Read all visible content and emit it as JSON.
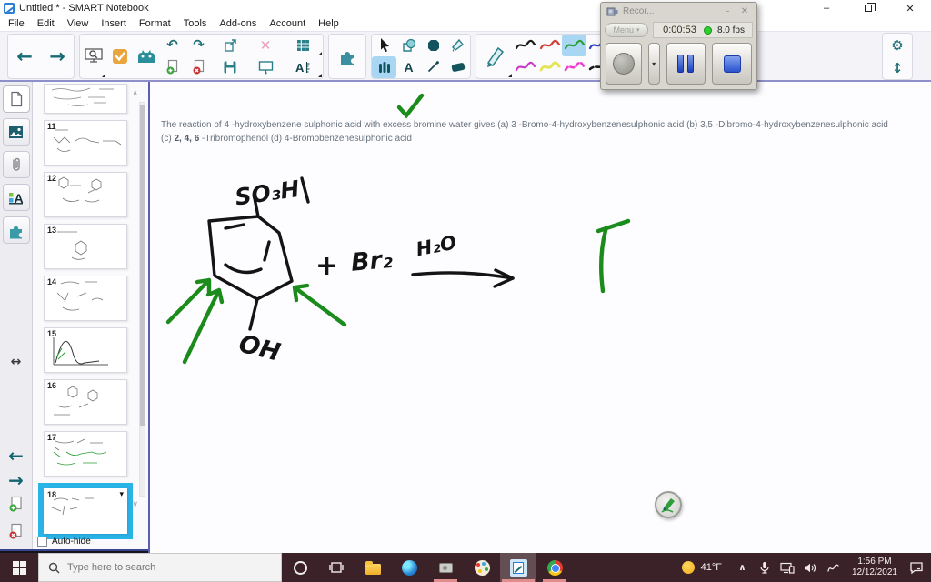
{
  "window": {
    "title": "Untitled * - SMART Notebook"
  },
  "menu_bar": {
    "items": [
      "File",
      "Edit",
      "View",
      "Insert",
      "Format",
      "Tools",
      "Add-ons",
      "Account",
      "Help"
    ]
  },
  "recorder": {
    "title": "Recor...",
    "menu_label": "Menu",
    "time": "0:00:53",
    "fps": "8.0 fps"
  },
  "canvas": {
    "question_line1": "The reaction of 4 -hydroxybenzene sulphonic acid with excess bromine water gives (a) 3 -Bromo-4-hydroxybenzenesulphonic acid (b) 3,5 -Dibromo-4-hydroxybenzenesulphonic acid",
    "question_line2_prefix": "(c) ",
    "question_line2_bold": "2, 4, 6",
    "question_line2_rest": " -Tribromophenol (d) 4-Bromobenzenesulphonic acid",
    "labels": {
      "so3h": "SO₃H",
      "oh": "OH",
      "plus": "+",
      "br2": "Br₂",
      "h2o": "H₂O"
    }
  },
  "sidebar": {
    "pages": [
      {
        "num": ""
      },
      {
        "num": "11"
      },
      {
        "num": "12"
      },
      {
        "num": "13"
      },
      {
        "num": "14"
      },
      {
        "num": "15"
      },
      {
        "num": "16"
      },
      {
        "num": "17"
      },
      {
        "num": "18"
      }
    ],
    "selected_page": "18",
    "autohide_label": "Auto-hide"
  },
  "taskbar": {
    "search_placeholder": "Type here to search",
    "weather": "41°F",
    "time": "1:56 PM",
    "date": "12/12/2021"
  },
  "icons": {
    "back": "←",
    "forward": "→",
    "undo": "↶",
    "redo": "↷",
    "gear": "⚙",
    "resize_v": "↕",
    "resize_h": "↔",
    "scroll_up": "∧",
    "scroll_down": "∨",
    "dropdown": "▾",
    "minimize": "–",
    "close": "✕",
    "delete_x": "✕",
    "tray_chevron": "∧"
  },
  "colors": {
    "taskbar_bg": "#3b2228",
    "accent_teal": "#1d6e75",
    "selected_blue": "#a9d7f3",
    "sidebar_selected": "#29b3e6",
    "ink_green": "#1b8c1b",
    "record_green": "#2bd32b",
    "recorder_button_blue": "#2b53cc",
    "underline_pink": "#e08d8d"
  }
}
